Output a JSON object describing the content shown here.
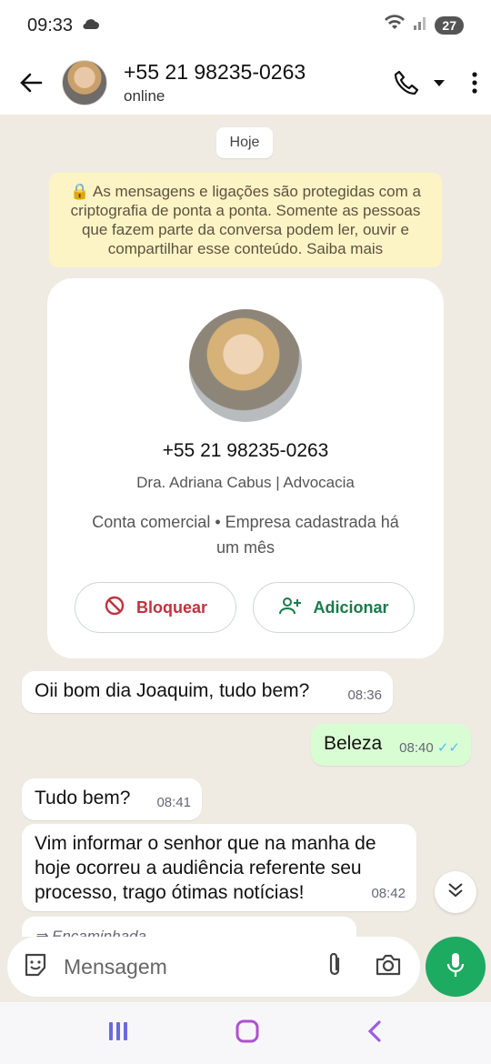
{
  "status_bar": {
    "time": "09:33",
    "battery": "27"
  },
  "header": {
    "name": "+55 21 98235-0263",
    "status": "online"
  },
  "chat": {
    "date_chip": "Hoje",
    "encryption_notice": "🔒 As mensagens e ligações são protegidas com a criptografia de ponta a ponta. Somente as pessoas que fazem parte da conversa podem ler, ouvir e compartilhar esse conteúdo. Saiba mais",
    "contact_card": {
      "phone": "+55 21 98235-0263",
      "business_name": "Dra. Adriana Cabus | Advocacia",
      "info": "Conta comercial • Empresa cadastrada há um mês",
      "block_label": "Bloquear",
      "add_label": "Adicionar"
    },
    "messages": [
      {
        "text": "Oii bom dia Joaquim, tudo bem?",
        "time": "08:36",
        "direction": "in"
      },
      {
        "text": "Beleza",
        "time": "08:40",
        "direction": "out",
        "ticks": "✓✓"
      },
      {
        "text": "Tudo bem?",
        "time": "08:41",
        "direction": "in"
      },
      {
        "text": "Vim informar o senhor que na manha de hoje ocorreu a audiência referente seu processo, trago ótimas notícias!",
        "time": "08:42",
        "direction": "in"
      },
      {
        "text": "Encaminhada",
        "direction": "in"
      }
    ]
  },
  "composer": {
    "placeholder": "Mensagem"
  },
  "colors": {
    "accent": "#1daa61",
    "outgoing_bubble": "#d9fdd3",
    "notice_bg": "#fdf4c5",
    "block_red": "#c0323f",
    "add_green": "#1b7a4a",
    "read_ticks": "#53bdeb"
  }
}
